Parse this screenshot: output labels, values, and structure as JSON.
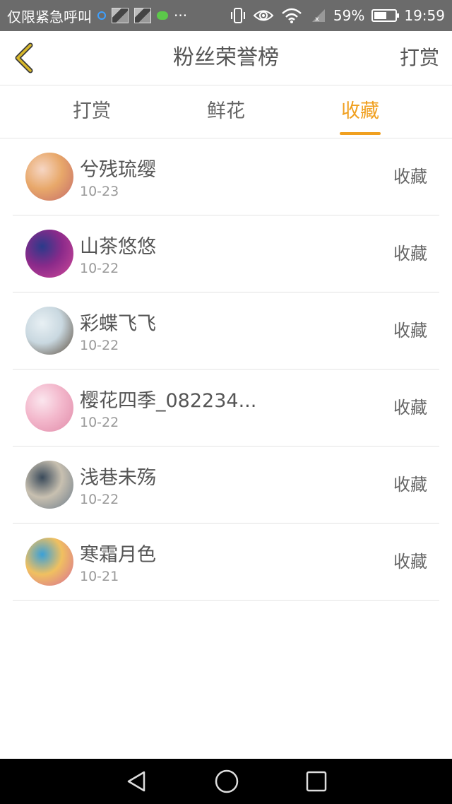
{
  "status_bar": {
    "carrier": "仅限紧急呼叫",
    "battery": "59%",
    "battery_level": 0.59,
    "time": "19:59",
    "icons": [
      "app-notification-icon",
      "photo-thumb-icon",
      "photo-thumb-icon",
      "wechat-icon",
      "more-dots-icon",
      "vibrate-icon",
      "eye-icon",
      "wifi-icon",
      "signal-icon",
      "battery-icon"
    ]
  },
  "header": {
    "title": "粉丝荣誉榜",
    "action": "打赏",
    "accent": "#c8a41c"
  },
  "tabs": [
    {
      "label": "打赏",
      "active": false
    },
    {
      "label": "鲜花",
      "active": false
    },
    {
      "label": "收藏",
      "active": true
    }
  ],
  "accent_color": "#f0a020",
  "fans": [
    {
      "name": "兮残琉缨",
      "date": "10-23",
      "action": "收藏",
      "avatar_colors": [
        "#f6d6c4",
        "#e8a86a",
        "#c46a6a"
      ]
    },
    {
      "name": "山茶悠悠",
      "date": "10-22",
      "action": "收藏",
      "avatar_colors": [
        "#2a3a8a",
        "#8a2a8a",
        "#d24a9a"
      ]
    },
    {
      "name": "彩蝶飞飞",
      "date": "10-22",
      "action": "收藏",
      "avatar_colors": [
        "#e8f0f4",
        "#c9d8e0",
        "#5a4a3a"
      ]
    },
    {
      "name": "樱花四季_082234...",
      "date": "10-22",
      "action": "收藏",
      "avatar_colors": [
        "#fbe6ee",
        "#f3b8cc",
        "#e08aa8"
      ]
    },
    {
      "name": "浅巷未殇",
      "date": "10-22",
      "action": "收藏",
      "avatar_colors": [
        "#3a4a5a",
        "#c8c0b0",
        "#6a7a8a"
      ]
    },
    {
      "name": "寒霜月色",
      "date": "10-21",
      "action": "收藏",
      "avatar_colors": [
        "#3aa0d8",
        "#f0c060",
        "#d86a9a"
      ]
    }
  ]
}
